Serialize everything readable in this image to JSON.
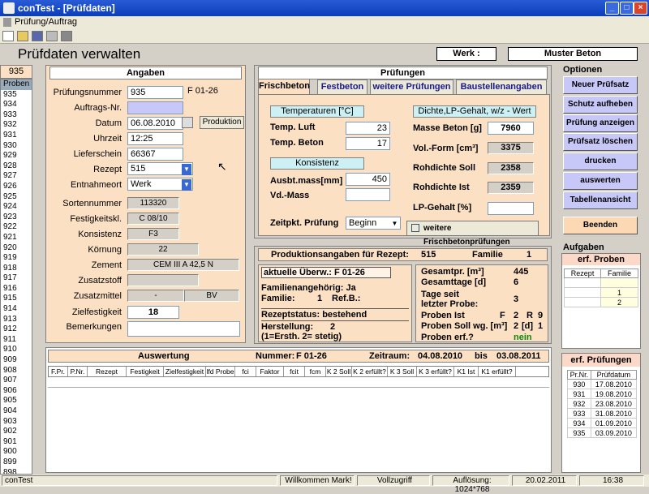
{
  "window": {
    "title": "conTest - [Prüfdaten]"
  },
  "menu": {
    "item": "Prüfung/Auftrag"
  },
  "header": {
    "title": "Prüfdaten verwalten",
    "werk_label": "Werk :",
    "werk_value": "Muster Beton"
  },
  "list": {
    "top_value": "935",
    "label": "Proben",
    "items": [
      "935",
      "934",
      "933",
      "932",
      "931",
      "930",
      "929",
      "928",
      "927",
      "926",
      "925",
      "924",
      "923",
      "922",
      "921",
      "920",
      "919",
      "918",
      "917",
      "916",
      "915",
      "914",
      "913",
      "912",
      "911",
      "910",
      "909",
      "908",
      "907",
      "906",
      "905",
      "904",
      "903",
      "902",
      "901",
      "900",
      "899",
      "898"
    ]
  },
  "angaben": {
    "title": "Angaben",
    "pruefungsnummer_label": "Prüfungsnummer",
    "pruefungsnummer": "935",
    "f_code": "F 01-26",
    "auftrags_label": "Auftrags-Nr.",
    "datum_label": "Datum",
    "datum": "06.08.2010",
    "produktion_button": "Produktion",
    "uhrzeit_label": "Uhrzeit",
    "uhrzeit": "12:25",
    "lieferschein_label": "Lieferschein",
    "lieferschein": "66367",
    "rezept_label": "Rezept",
    "rezept": "515",
    "entnahme_label": "Entnahmeort",
    "entnahme": "Werk",
    "sortennummer_label": "Sortennummer",
    "sortennummer": "113320",
    "festigkeit_label": "Festigkeitskl.",
    "festigkeit": "C 08/10",
    "konsistenz_label": "Konsistenz",
    "konsistenz": "F3",
    "koernung_label": "Körnung",
    "koernung": "22",
    "zement_label": "Zement",
    "zement": "CEM III A 42,5 N",
    "zusatzstoff_label": "Zusatzstoff",
    "zusatzmittel_label": "Zusatzmittel",
    "zusatzmittel_a": "-",
    "zusatzmittel_b": "BV",
    "zielfestigkeit_label": "Zielfestigkeit",
    "zielfestigkeit": "18",
    "bemerkungen_label": "Bemerkungen"
  },
  "pruefungen": {
    "title": "Prüfungen",
    "tabs": [
      "Frischbeton",
      "Festbeton",
      "weitere Prüfungen",
      "Baustellenangaben"
    ],
    "temp_head": "Temperaturen [°C]",
    "temp_luft_label": "Temp. Luft",
    "temp_luft": "23",
    "temp_beton_label": "Temp. Beton",
    "temp_beton": "17",
    "konsistenz_head": "Konsistenz",
    "ausbt_label": "Ausbt.mass[mm]",
    "ausbt": "450",
    "vd_label": "Vd.-Mass",
    "zeitpkt_label": "Zeitpkt. Prüfung",
    "zeitpkt": "Beginn",
    "dichte_head": "Dichte,LP-Gehalt, w/z - Wert",
    "masse_label": "Masse Beton [g]",
    "masse": "7960",
    "volform_label": "Vol.-Form [cm³]",
    "volform": "3375",
    "rohsoll_label": "Rohdichte Soll",
    "rohsoll": "2358",
    "rohist_label": "Rohdichte Ist",
    "rohist": "2359",
    "lp_label": "LP-Gehalt [%]",
    "weitere_button": "weitere Frischbetonprüfungen"
  },
  "produktion": {
    "title": "Produktionsangaben für Rezept:",
    "rezept": "515",
    "familie_label": "Familie",
    "familie": "1",
    "aktuelle_label": "aktuelle Überw.:",
    "aktuelle": "F 01-26",
    "fam_zug_label": "Familienangehörig:",
    "fam_zug": "Ja",
    "familie2_label": "Familie:",
    "familie2": "1",
    "refb_label": "Ref.B.:",
    "rezeptstatus_label": "Rezeptstatus:",
    "rezeptstatus": "bestehend",
    "herstellung_label": "Herstellung:",
    "herstellung": "2",
    "herstellung_note": "(1=Ersth. 2= stetig)",
    "gesamtpr_label": "Gesamtpr. [m³]",
    "gesamtpr": "445",
    "gesamttage_label": "Gesamttage [d]",
    "gesamttage": "6",
    "tage_label": "Tage seit",
    "tage_label2": "letzter Probe:",
    "tage": "3",
    "probenist_label": "Proben Ist",
    "probenist_f": "F",
    "probenist_fv": "2",
    "probenist_r": "R",
    "probenist_rv": "9",
    "probensoll_label": "Proben Soll wg. [m³]",
    "probensoll_a": "2",
    "probensoll_d": "[d]",
    "probensoll_b": "1",
    "proben_erf_label": "Proben erf.?",
    "proben_erf": "nein"
  },
  "auswertung": {
    "title": "Auswertung",
    "nummer_label": "Nummer:",
    "nummer": "F 01-26",
    "zeitraum_label": "Zeitraum:",
    "von": "04.08.2010",
    "bis_label": "bis",
    "bis": "03.08.2011",
    "columns": [
      "F.Pr.",
      "P.Nr.",
      "Rezept",
      "Festigkeit",
      "Zielfestigkeit",
      "lfd Probe",
      "fci",
      "Faktor",
      "fcit",
      "fcm",
      "K 2 Soll",
      "K 2 erfüllt?",
      "K 3 Soll",
      "K 3 erfüllt?",
      "K1 Ist",
      "K1 erfüllt?"
    ]
  },
  "optionen": {
    "title": "Optionen",
    "buttons": [
      "Neuer Prüfsatz",
      "Schutz aufheben",
      "Prüfung anzeigen",
      "Prüfsatz löschen",
      "drucken",
      "auswerten",
      "Tabellenansicht"
    ],
    "beenden": "Beenden"
  },
  "aufgaben": {
    "title": "Aufgaben",
    "erf_proben": "erf. Proben",
    "proben_cols": [
      "Rezept",
      "Familie"
    ],
    "proben_rows": [
      [
        "",
        ""
      ],
      [
        "",
        "1"
      ],
      [
        "",
        "2"
      ]
    ],
    "erf_pruefungen": "erf. Prüfungen",
    "pr_cols": [
      "Pr.Nr.",
      "Prüfdatum"
    ],
    "pr_rows": [
      [
        "930",
        "17.08.2010"
      ],
      [
        "931",
        "19.08.2010"
      ],
      [
        "932",
        "23.08.2010"
      ],
      [
        "933",
        "31.08.2010"
      ],
      [
        "934",
        "01.09.2010"
      ],
      [
        "935",
        "03.09.2010"
      ]
    ]
  },
  "status": {
    "app": "conTest",
    "welcome": "Willkommen Mark!",
    "zugriff": "Vollzugriff",
    "aufloesung": "Auflösung: 1024*768",
    "date": "20.02.2011",
    "time": "16:38"
  }
}
